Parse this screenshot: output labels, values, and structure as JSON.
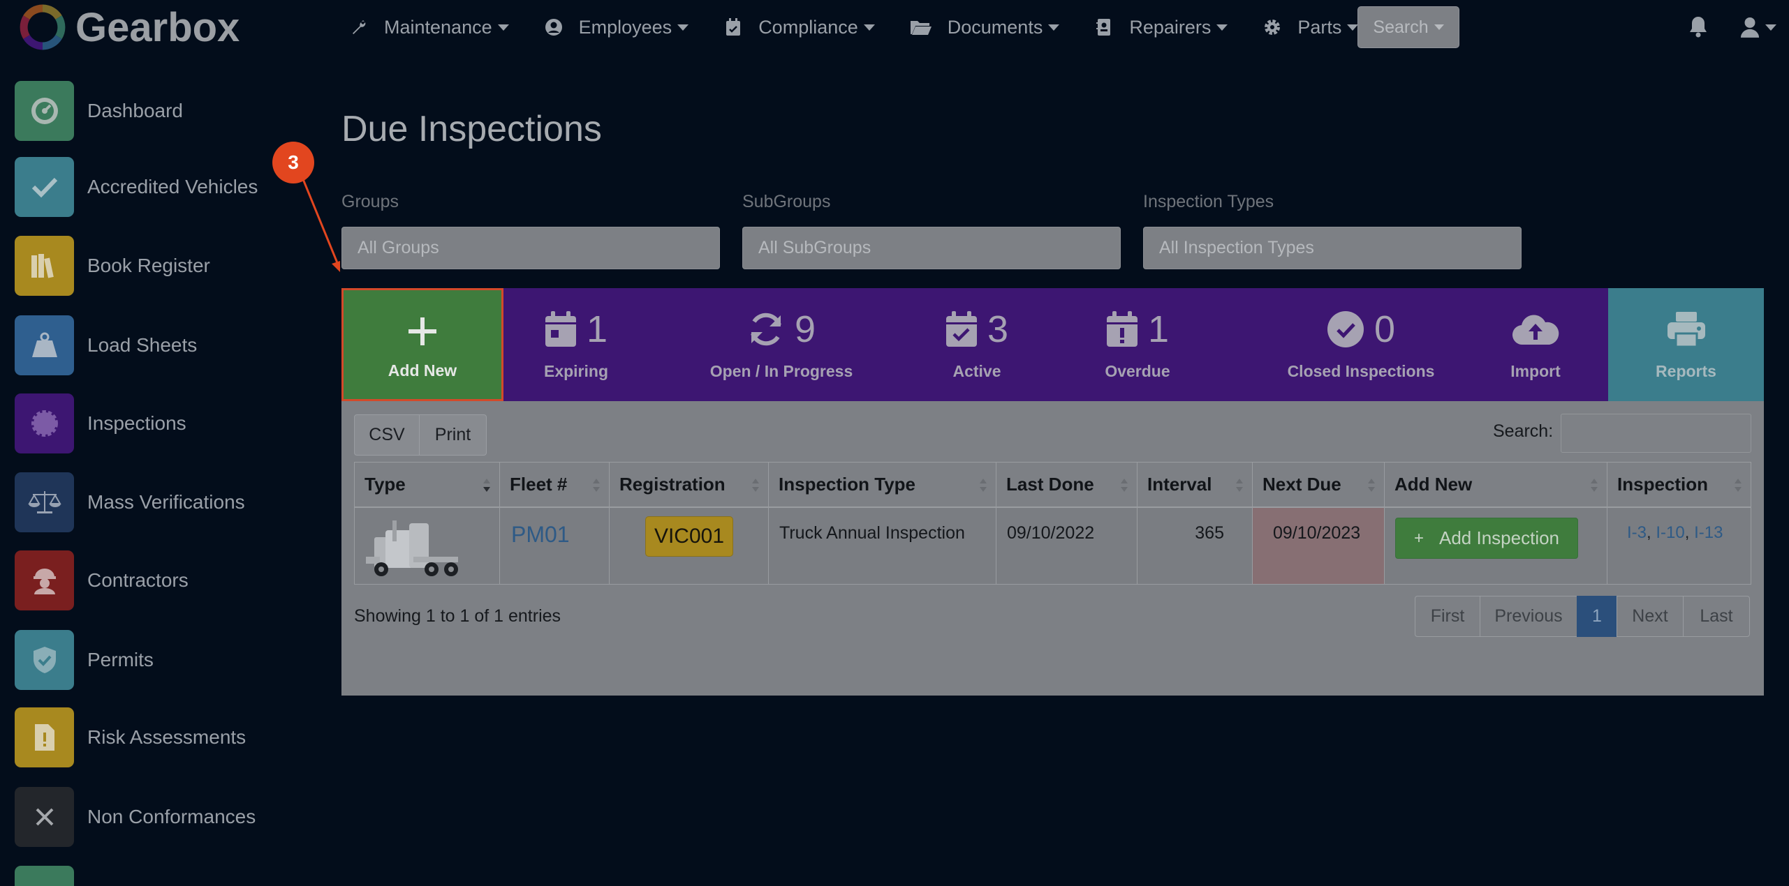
{
  "app": {
    "name": "Gearbox"
  },
  "nav": {
    "items": [
      {
        "label": "Maintenance",
        "icon": "wrench-icon"
      },
      {
        "label": "Employees",
        "icon": "user-circle-icon"
      },
      {
        "label": "Compliance",
        "icon": "calendar-check-icon"
      },
      {
        "label": "Documents",
        "icon": "folder-open-icon"
      },
      {
        "label": "Repairers",
        "icon": "id-card-icon"
      },
      {
        "label": "Parts",
        "icon": "gear-icon"
      }
    ],
    "search_label": "Search"
  },
  "sidebar": {
    "items": [
      {
        "label": "Dashboard",
        "icon": "gauge-icon",
        "color": "#3b7a5c"
      },
      {
        "label": "Accredited Vehicles",
        "icon": "check-icon",
        "color": "#3b7d8c"
      },
      {
        "label": "Book Register",
        "icon": "books-icon",
        "color": "#a8891f"
      },
      {
        "label": "Load Sheets",
        "icon": "weight-icon",
        "color": "#2f5f8f"
      },
      {
        "label": "Inspections",
        "icon": "badge-icon",
        "color": "#3d1672"
      },
      {
        "label": "Mass Verifications",
        "icon": "scale-icon",
        "color": "#1f3558"
      },
      {
        "label": "Contractors",
        "icon": "hard-hat-icon",
        "color": "#7a1f1f"
      },
      {
        "label": "Permits",
        "icon": "shield-check-icon",
        "color": "#3b7d8c"
      },
      {
        "label": "Risk Assessments",
        "icon": "file-exclamation-icon",
        "color": "#a8891f"
      },
      {
        "label": "Non Conformances",
        "icon": "close-icon",
        "color": "#23262b"
      }
    ]
  },
  "page": {
    "title": "Due Inspections"
  },
  "filters": {
    "groups": {
      "label": "Groups",
      "value": "All Groups"
    },
    "subgroups": {
      "label": "SubGroups",
      "value": "All SubGroups"
    },
    "inspection_types": {
      "label": "Inspection Types",
      "value": "All Inspection Types"
    }
  },
  "stats": {
    "add_new": "Add New",
    "expiring": {
      "count": "1",
      "label": "Expiring"
    },
    "open": {
      "count": "9",
      "label": "Open / In Progress"
    },
    "active": {
      "count": "3",
      "label": "Active"
    },
    "overdue": {
      "count": "1",
      "label": "Overdue"
    },
    "closed": {
      "count": "0",
      "label": "Closed Inspections"
    },
    "import": "Import",
    "reports": "Reports"
  },
  "table_tools": {
    "csv": "CSV",
    "print": "Print",
    "search_label": "Search:"
  },
  "table": {
    "headers": [
      "Type",
      "Fleet #",
      "Registration",
      "Inspection Type",
      "Last Done",
      "Interval",
      "Next Due",
      "Add New",
      "Inspection"
    ],
    "row": {
      "fleet": "PM01",
      "registration": "VIC001",
      "inspection_type": "Truck Annual Inspection",
      "last_done": "09/10/2022",
      "interval": "365",
      "next_due": "09/10/2023",
      "add_button": "Add Inspection",
      "links": [
        "I-3",
        "I-10",
        "I-13"
      ]
    }
  },
  "footer": {
    "showing": "Showing 1 to 1 of 1 entries",
    "pager": [
      "First",
      "Previous",
      "1",
      "Next",
      "Last"
    ]
  },
  "annotation": {
    "step": "3"
  },
  "colors": {
    "accent_green": "#3f7c3d",
    "stats_purple": "#3d1672",
    "reports_teal": "#3b7d8c",
    "annotation_red": "#e2461f"
  }
}
